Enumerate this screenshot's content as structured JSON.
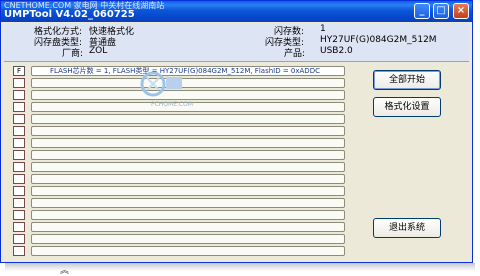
{
  "window": {
    "watermark_title": "CNETHOME.COM 家电网 中关村在线湖南站",
    "title": "UMPTool V4.02_060725",
    "buttons": {
      "minimize": "_",
      "maximize": "□",
      "close": "×"
    }
  },
  "info": {
    "format_mode_label": "格式化方式:",
    "format_mode_value": "快速格式化",
    "flash_disk_type_label": "闪存盘类型:",
    "flash_disk_type_value": "普通盘",
    "vendor_label": "厂商:",
    "vendor_value": "ZOL",
    "flash_count_label": "闪存数:",
    "flash_count_value": "1",
    "flash_type_label": "闪存类型:",
    "flash_type_value": "HY27UF(G)084G2M_512M",
    "product_label": "产品:",
    "product_value": "USB2.0"
  },
  "device_list": {
    "header_check_label": "F",
    "first_row_text": "FLASH芯片数 = 1, FLASH类型 = HY27UF(G)084G2M_512M, FlashID = 0xADDC"
  },
  "actions": {
    "start_all": "全部开始",
    "format_settings": "格式化设置",
    "exit": "退出系统"
  },
  "watermark": {
    "text": "PCHOME.COM"
  }
}
